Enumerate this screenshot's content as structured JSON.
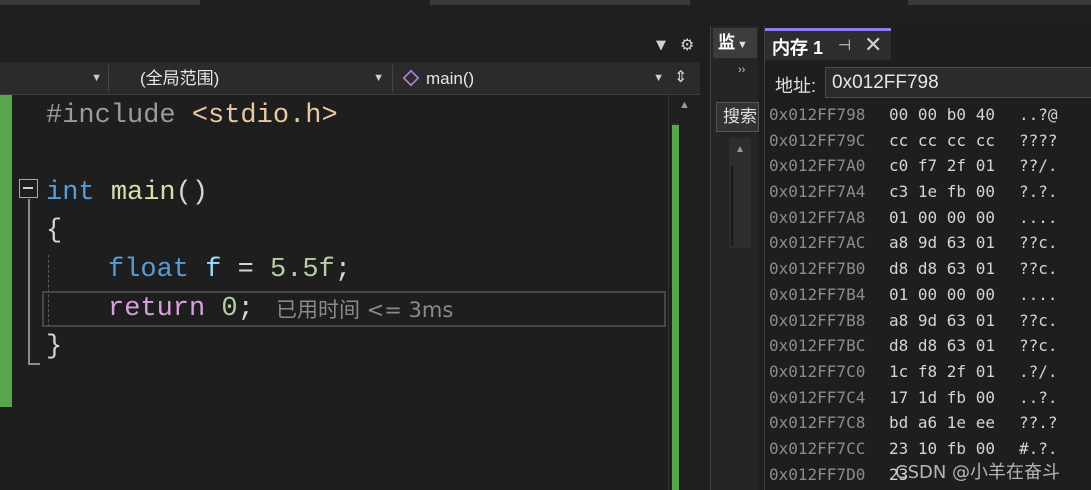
{
  "editor": {
    "nav": {
      "project_dropdown": "",
      "scope_dropdown": "(全局范围)",
      "function_dropdown": "main()"
    },
    "code": {
      "line1": {
        "directive": "#include",
        "header": "<stdio.h>"
      },
      "line3": {
        "type": "int",
        "name": "main",
        "parens": "()"
      },
      "line4": {
        "brace": "{"
      },
      "line5": {
        "type": "float",
        "var": "f",
        "op": " = ",
        "value": "5.5f",
        "semi": ";"
      },
      "line6": {
        "keyword": "return",
        "value": "0",
        "semi": ";"
      },
      "line7": {
        "brace": "}"
      }
    },
    "perf_tip": "已用时间 <= 3ms"
  },
  "watch": {
    "tab_label": "监",
    "search_label": "搜索"
  },
  "memory": {
    "tab_title": "内存 1",
    "address_label": "地址:",
    "address_value": "0x012FF798",
    "rows": [
      {
        "addr": "0x012FF798",
        "bytes": "00 00 b0 40",
        "chars": "..?@"
      },
      {
        "addr": "0x012FF79C",
        "bytes": "cc cc cc cc",
        "chars": "????"
      },
      {
        "addr": "0x012FF7A0",
        "bytes": "c0 f7 2f 01",
        "chars": "??/."
      },
      {
        "addr": "0x012FF7A4",
        "bytes": "c3 1e fb 00",
        "chars": "?.?."
      },
      {
        "addr": "0x012FF7A8",
        "bytes": "01 00 00 00",
        "chars": "...."
      },
      {
        "addr": "0x012FF7AC",
        "bytes": "a8 9d 63 01",
        "chars": "??c."
      },
      {
        "addr": "0x012FF7B0",
        "bytes": "d8 d8 63 01",
        "chars": "??c."
      },
      {
        "addr": "0x012FF7B4",
        "bytes": "01 00 00 00",
        "chars": "...."
      },
      {
        "addr": "0x012FF7B8",
        "bytes": "a8 9d 63 01",
        "chars": "??c."
      },
      {
        "addr": "0x012FF7BC",
        "bytes": "d8 d8 63 01",
        "chars": "??c."
      },
      {
        "addr": "0x012FF7C0",
        "bytes": "1c f8 2f 01",
        "chars": ".?/."
      },
      {
        "addr": "0x012FF7C4",
        "bytes": "17 1d fb 00",
        "chars": "..?."
      },
      {
        "addr": "0x012FF7C8",
        "bytes": "bd a6 1e ee",
        "chars": "??.?"
      },
      {
        "addr": "0x012FF7CC",
        "bytes": "23 10 fb 00",
        "chars": "#.?."
      },
      {
        "addr": "0x012FF7D0",
        "bytes": "23",
        "chars": ""
      }
    ]
  },
  "watermark": "CSDN @小羊在奋斗",
  "colors": {
    "accent": "#8b7cf0",
    "change_bar": "#57a64a",
    "keyword": "#569cd6",
    "control_keyword": "#d8a0df",
    "number": "#b5cea8",
    "function": "#dcdcaa",
    "variable": "#9cdcfe"
  },
  "icons": {
    "dropdown": "chevron-down-icon",
    "settings": "gear-icon",
    "pin": "pin-icon",
    "close": "close-icon",
    "split": "split-editor-icon",
    "function": "method-cube-icon"
  }
}
